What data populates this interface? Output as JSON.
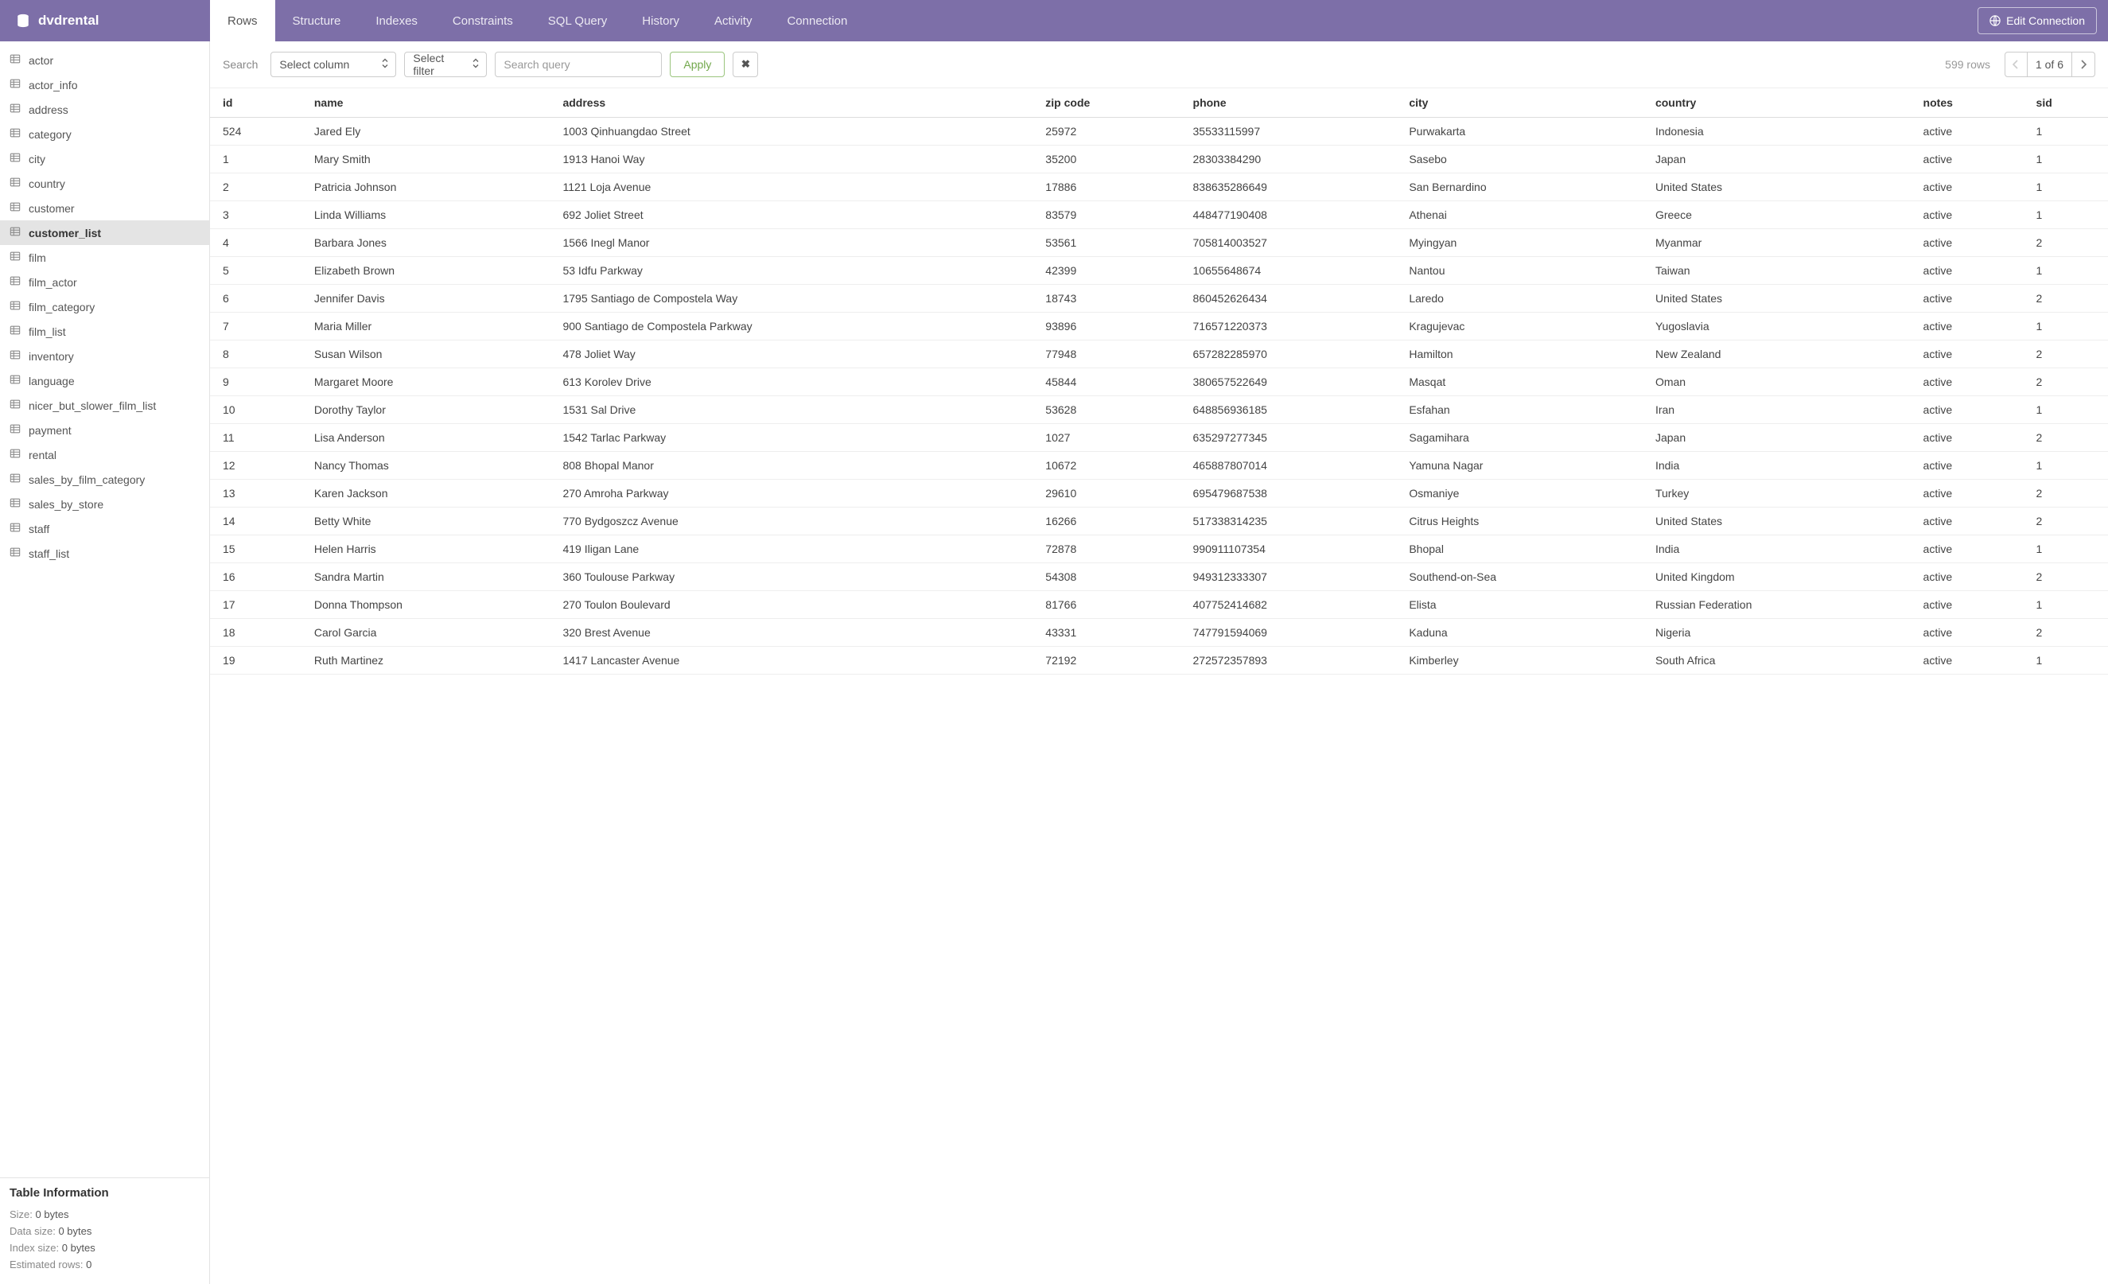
{
  "header": {
    "db_name": "dvdrental",
    "tabs": [
      "Rows",
      "Structure",
      "Indexes",
      "Constraints",
      "SQL Query",
      "History",
      "Activity",
      "Connection"
    ],
    "active_tab": 0,
    "edit_connection": "Edit Connection"
  },
  "sidebar": {
    "tables": [
      "actor",
      "actor_info",
      "address",
      "category",
      "city",
      "country",
      "customer",
      "customer_list",
      "film",
      "film_actor",
      "film_category",
      "film_list",
      "inventory",
      "language",
      "nicer_but_slower_film_list",
      "payment",
      "rental",
      "sales_by_film_category",
      "sales_by_store",
      "staff",
      "staff_list"
    ],
    "active": "customer_list",
    "info_title": "Table Information",
    "info": {
      "size_label": "Size:",
      "size_value": "0 bytes",
      "data_size_label": "Data size:",
      "data_size_value": "0 bytes",
      "index_size_label": "Index size:",
      "index_size_value": "0 bytes",
      "est_rows_label": "Estimated rows:",
      "est_rows_value": "0"
    }
  },
  "search": {
    "label": "Search",
    "select_column": "Select column",
    "select_filter": "Select filter",
    "query_placeholder": "Search query",
    "apply": "Apply",
    "rows_count": "599 rows",
    "page_indicator": "1 of 6"
  },
  "table": {
    "columns": [
      "id",
      "name",
      "address",
      "zip code",
      "phone",
      "city",
      "country",
      "notes",
      "sid"
    ],
    "rows": [
      [
        "524",
        "Jared Ely",
        "1003 Qinhuangdao Street",
        "25972",
        "35533115997",
        "Purwakarta",
        "Indonesia",
        "active",
        "1"
      ],
      [
        "1",
        "Mary Smith",
        "1913 Hanoi Way",
        "35200",
        "28303384290",
        "Sasebo",
        "Japan",
        "active",
        "1"
      ],
      [
        "2",
        "Patricia Johnson",
        "1121 Loja Avenue",
        "17886",
        "838635286649",
        "San Bernardino",
        "United States",
        "active",
        "1"
      ],
      [
        "3",
        "Linda Williams",
        "692 Joliet Street",
        "83579",
        "448477190408",
        "Athenai",
        "Greece",
        "active",
        "1"
      ],
      [
        "4",
        "Barbara Jones",
        "1566 Inegl Manor",
        "53561",
        "705814003527",
        "Myingyan",
        "Myanmar",
        "active",
        "2"
      ],
      [
        "5",
        "Elizabeth Brown",
        "53 Idfu Parkway",
        "42399",
        "10655648674",
        "Nantou",
        "Taiwan",
        "active",
        "1"
      ],
      [
        "6",
        "Jennifer Davis",
        "1795 Santiago de Compostela Way",
        "18743",
        "860452626434",
        "Laredo",
        "United States",
        "active",
        "2"
      ],
      [
        "7",
        "Maria Miller",
        "900 Santiago de Compostela Parkway",
        "93896",
        "716571220373",
        "Kragujevac",
        "Yugoslavia",
        "active",
        "1"
      ],
      [
        "8",
        "Susan Wilson",
        "478 Joliet Way",
        "77948",
        "657282285970",
        "Hamilton",
        "New Zealand",
        "active",
        "2"
      ],
      [
        "9",
        "Margaret Moore",
        "613 Korolev Drive",
        "45844",
        "380657522649",
        "Masqat",
        "Oman",
        "active",
        "2"
      ],
      [
        "10",
        "Dorothy Taylor",
        "1531 Sal Drive",
        "53628",
        "648856936185",
        "Esfahan",
        "Iran",
        "active",
        "1"
      ],
      [
        "11",
        "Lisa Anderson",
        "1542 Tarlac Parkway",
        "1027",
        "635297277345",
        "Sagamihara",
        "Japan",
        "active",
        "2"
      ],
      [
        "12",
        "Nancy Thomas",
        "808 Bhopal Manor",
        "10672",
        "465887807014",
        "Yamuna Nagar",
        "India",
        "active",
        "1"
      ],
      [
        "13",
        "Karen Jackson",
        "270 Amroha Parkway",
        "29610",
        "695479687538",
        "Osmaniye",
        "Turkey",
        "active",
        "2"
      ],
      [
        "14",
        "Betty White",
        "770 Bydgoszcz Avenue",
        "16266",
        "517338314235",
        "Citrus Heights",
        "United States",
        "active",
        "2"
      ],
      [
        "15",
        "Helen Harris",
        "419 Iligan Lane",
        "72878",
        "990911107354",
        "Bhopal",
        "India",
        "active",
        "1"
      ],
      [
        "16",
        "Sandra Martin",
        "360 Toulouse Parkway",
        "54308",
        "949312333307",
        "Southend-on-Sea",
        "United Kingdom",
        "active",
        "2"
      ],
      [
        "17",
        "Donna Thompson",
        "270 Toulon Boulevard",
        "81766",
        "407752414682",
        "Elista",
        "Russian Federation",
        "active",
        "1"
      ],
      [
        "18",
        "Carol Garcia",
        "320 Brest Avenue",
        "43331",
        "747791594069",
        "Kaduna",
        "Nigeria",
        "active",
        "2"
      ],
      [
        "19",
        "Ruth Martinez",
        "1417 Lancaster Avenue",
        "72192",
        "272572357893",
        "Kimberley",
        "South Africa",
        "active",
        "1"
      ]
    ]
  }
}
